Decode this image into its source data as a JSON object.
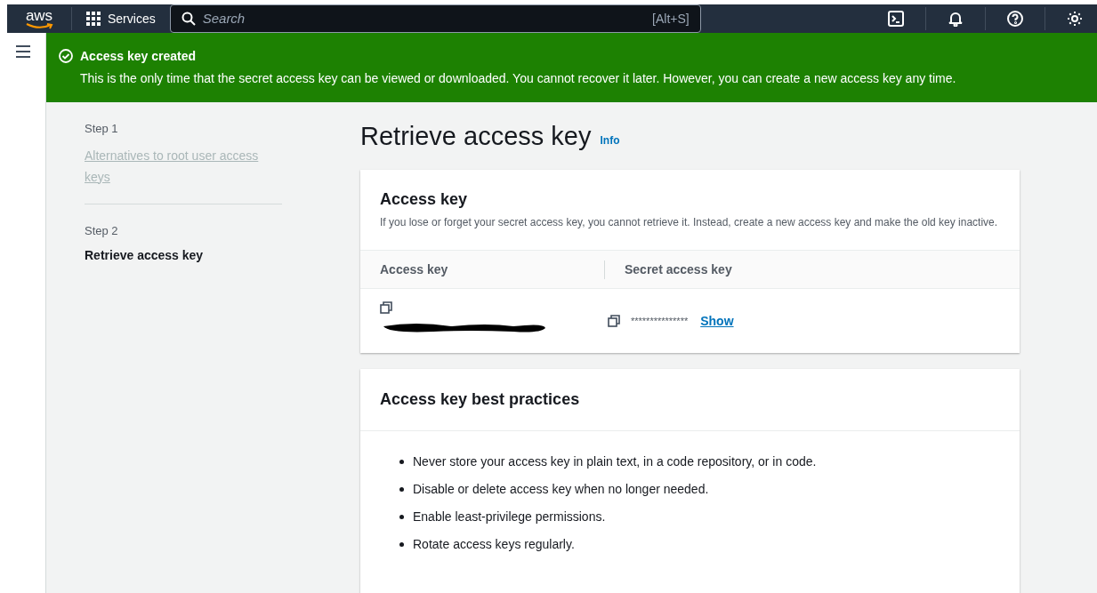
{
  "top_nav": {
    "logo": "aws",
    "services": "Services",
    "search": {
      "placeholder": "Search",
      "shortcut": "[Alt+S]"
    }
  },
  "banner": {
    "title": "Access key created",
    "message": "This is the only time that the secret access key can be viewed or downloaded. You cannot recover it later. However, you can create a new access key any time."
  },
  "steps": [
    {
      "step": "Step 1",
      "label": "Alternatives to root user access keys",
      "selected": false
    },
    {
      "step": "Step 2",
      "label": "Retrieve access key",
      "selected": true
    }
  ],
  "page": {
    "title": "Retrieve access key",
    "info": "Info"
  },
  "access_key_panel": {
    "title": "Access key",
    "description": "If you lose or forget your secret access key, you cannot retrieve it. Instead, create a new access key and make the old key inactive.",
    "columns": [
      "Access key",
      "Secret access key"
    ],
    "secret": "***************",
    "show": "Show"
  },
  "best_practices": {
    "title": "Access key best practices",
    "items": [
      "Never store your access key in plain text, in a code repository, or in code.",
      "Disable or delete access key when no longer needed.",
      "Enable least-privilege permissions.",
      "Rotate access keys regularly."
    ]
  }
}
